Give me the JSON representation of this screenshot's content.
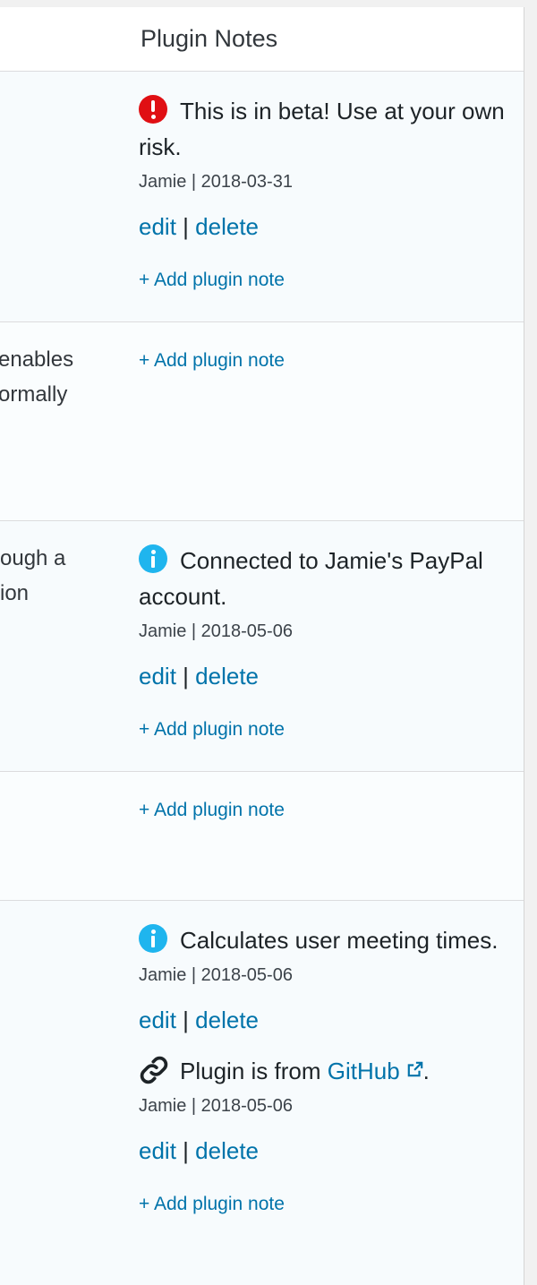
{
  "header": {
    "title": "Plugin Notes"
  },
  "rows": [
    {
      "desc_lines": [],
      "notes": [
        {
          "icon": "error-icon",
          "text": "This is in beta! Use at your own risk.",
          "author": "Jamie",
          "date": "2018-03-31",
          "meta": "Jamie | 2018-03-31",
          "edit": "edit",
          "sep": "|",
          "delete": "delete"
        }
      ],
      "add_note": "+ Add plugin note"
    },
    {
      "desc_lines": [
        "enables",
        "ormally"
      ],
      "notes": [],
      "add_note": "+ Add plugin note"
    },
    {
      "desc_lines": [
        "ough a",
        "ion"
      ],
      "notes": [
        {
          "icon": "info-icon",
          "text": "Connected to Jamie's PayPal account.",
          "meta": "Jamie | 2018-05-06",
          "edit": "edit",
          "sep": "|",
          "delete": "delete"
        }
      ],
      "add_note": "+ Add plugin note"
    },
    {
      "desc_lines": [],
      "notes": [],
      "add_note": "+ Add plugin note"
    },
    {
      "desc_lines": [],
      "notes": [
        {
          "icon": "info-icon",
          "text": "Calculates user meeting times.",
          "meta": "Jamie | 2018-05-06",
          "edit": "edit",
          "sep": "|",
          "delete": "delete"
        },
        {
          "icon": "link-icon",
          "text_before": "Plugin is from ",
          "link": "GitHub",
          "text_after": ".",
          "meta": "Jamie | 2018-05-06",
          "edit": "edit",
          "sep": "|",
          "delete": "delete"
        }
      ],
      "add_note": "+ Add plugin note"
    }
  ],
  "colors": {
    "link": "#0073aa",
    "error": "#e00f13",
    "info": "#1fb5ee"
  }
}
